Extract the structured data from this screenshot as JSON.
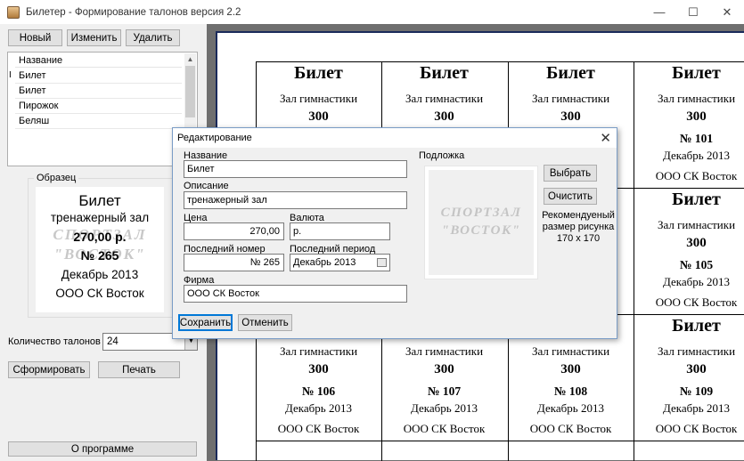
{
  "window": {
    "title": "Билетер - Формирование талонов версия 2.2",
    "minimize_glyph": "—",
    "maximize_glyph": "☐",
    "close_glyph": "✕"
  },
  "toolbar": {
    "new_label": "Новый",
    "edit_label": "Изменить",
    "delete_label": "Удалить"
  },
  "list": {
    "header": "Название",
    "current_marker": "I",
    "items": [
      "Билет",
      "Билет",
      "Пирожок",
      "Беляш"
    ],
    "scroll_up_glyph": "▲",
    "scroll_down_glyph": "▼"
  },
  "sample": {
    "group_label": "Образец",
    "watermark_line1": "СПОРТЗАЛ",
    "watermark_line2": "\"ВОСТОК\"",
    "title": "Билет",
    "hall": "тренажерный зал",
    "price": "270,00 р.",
    "number": "№ 265",
    "period": "Декабрь 2013",
    "firm": "ООО СК Восток"
  },
  "controls": {
    "quantity_label": "Количество талонов",
    "quantity_value": "24",
    "combo_arrow": "▼",
    "generate_label": "Сформировать",
    "print_label": "Печать",
    "about_label": "О программе"
  },
  "preview": {
    "tickets": [
      {
        "title": "Билет",
        "hall": "Зал гимнастики",
        "price": "300"
      },
      {
        "title": "Билет",
        "hall": "Зал гимнастики",
        "price": "300"
      },
      {
        "title": "Билет",
        "hall": "Зал гимнастики",
        "price": "300"
      },
      {
        "title": "Билет",
        "hall": "Зал гимнастики",
        "price": "300",
        "number": "№ 101",
        "period": "Декабрь 2013",
        "firm": "ООО СК Восток"
      },
      {
        "title": "Билет",
        "hall": "Зал гимнастики",
        "price": "300",
        "number": "№ 105",
        "period": "Декабрь 2013",
        "firm": "ООО СК Восток"
      },
      {
        "title": "Билет"
      },
      {
        "hall": "Зал гимнастики",
        "price": "300",
        "number": "№ 106",
        "period": "Декабрь 2013",
        "firm": "ООО СК Восток"
      },
      {
        "hall": "Зал гимнастики",
        "price": "300",
        "number": "№ 107",
        "period": "Декабрь 2013",
        "firm": "ООО СК Восток"
      },
      {
        "hall": "Зал гимнастики",
        "price": "300",
        "number": "№ 108",
        "period": "Декабрь 2013",
        "firm": "ООО СК Восток"
      },
      {
        "hall": "Зал гимнастики",
        "price": "300",
        "number": "№ 109",
        "period": "Декабрь 2013",
        "firm": "ООО СК Восток"
      }
    ]
  },
  "dialog": {
    "title": "Редактирование",
    "close_glyph": "✕",
    "name_label": "Название",
    "name_value": "Билет",
    "description_label": "Описание",
    "description_value": "тренажерный зал",
    "price_label": "Цена",
    "price_value": "270,00",
    "currency_label": "Валюта",
    "currency_value": "р.",
    "last_number_label": "Последний номер",
    "last_number_value": "№ 265",
    "last_period_label": "Последний период",
    "last_period_value": "Декабрь  2013",
    "firm_label": "Фирма",
    "firm_value": "ООО СК Восток",
    "substrate_label": "Подложка",
    "substrate_wm_line1": "СПОРТЗАЛ",
    "substrate_wm_line2": "\"ВОСТОК\"",
    "choose_label": "Выбрать",
    "clear_label": "Очистить",
    "hint_line1": "Рекомендуеный",
    "hint_line2": "размер рисунка",
    "hint_line3": "170 x 170",
    "save_label": "Сохранить",
    "cancel_label": "Отменить"
  },
  "colors": {
    "accent": "#0078d7",
    "preview_bg": "#6f6f6f",
    "sheet_border": "#1a2a5a",
    "watermark": "#c8c8c8"
  }
}
